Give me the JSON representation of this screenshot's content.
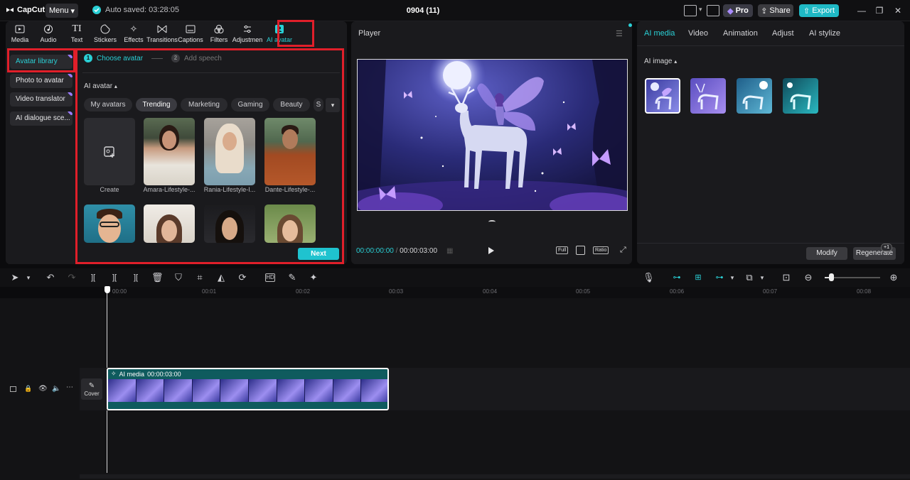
{
  "app": {
    "logo": "CapCut",
    "menu_label": "Menu",
    "autosave": "Auto saved: 03:28:05",
    "project_title": "0904 (11)"
  },
  "header_buttons": {
    "pro": "Pro",
    "share": "Share",
    "export": "Export"
  },
  "toolbar": [
    {
      "label": "Media",
      "icon": "media-icon"
    },
    {
      "label": "Audio",
      "icon": "audio-icon"
    },
    {
      "label": "Text",
      "icon": "text-icon"
    },
    {
      "label": "Stickers",
      "icon": "stickers-icon"
    },
    {
      "label": "Effects",
      "icon": "effects-icon"
    },
    {
      "label": "Transitions",
      "icon": "transitions-icon"
    },
    {
      "label": "Captions",
      "icon": "captions-icon"
    },
    {
      "label": "Filters",
      "icon": "filters-icon"
    },
    {
      "label": "Adjustmen",
      "icon": "adjustment-icon"
    },
    {
      "label": "AI avatar",
      "icon": "ai-avatar-icon"
    }
  ],
  "sidebar": [
    {
      "label": "Avatar library"
    },
    {
      "label": "Photo to avatar"
    },
    {
      "label": "Video translator"
    },
    {
      "label": "AI dialogue sce..."
    }
  ],
  "steps": [
    {
      "num": "1",
      "label": "Choose avatar"
    },
    {
      "num": "2",
      "label": "Add speech"
    }
  ],
  "avatar_section": {
    "title": "AI avatar",
    "chips": [
      "My avatars",
      "Trending",
      "Marketing",
      "Gaming",
      "Beauty",
      "S"
    ]
  },
  "avatars": [
    {
      "label": "Create"
    },
    {
      "label": "Amara-Lifestyle-..."
    },
    {
      "label": "Rania-Lifestyle-I..."
    },
    {
      "label": "Dante-Lifestyle-..."
    }
  ],
  "next_label": "Next",
  "player": {
    "title": "Player",
    "current_time": "00:00:00:00",
    "separator": "/",
    "total_time": "00:00:03:00",
    "full": "Full",
    "ratio": "Ratio"
  },
  "right": {
    "tabs": [
      "AI media",
      "Video",
      "Animation",
      "Adjust",
      "AI stylize"
    ],
    "section": "AI image",
    "modify": "Modify",
    "regenerate": "Regenerate",
    "regen_badge": "+1"
  },
  "ruler": [
    "00:00",
    "00:01",
    "00:02",
    "00:03",
    "00:04",
    "00:05",
    "00:06",
    "00:07",
    "00:08"
  ],
  "clip": {
    "label": "AI media",
    "duration": "00:00:03:00"
  },
  "cover_label": "Cover",
  "colors": {
    "accent": "#2ad0d6",
    "highlight_box": "#e01f2a",
    "clip_bg": "#0f5b5e"
  }
}
